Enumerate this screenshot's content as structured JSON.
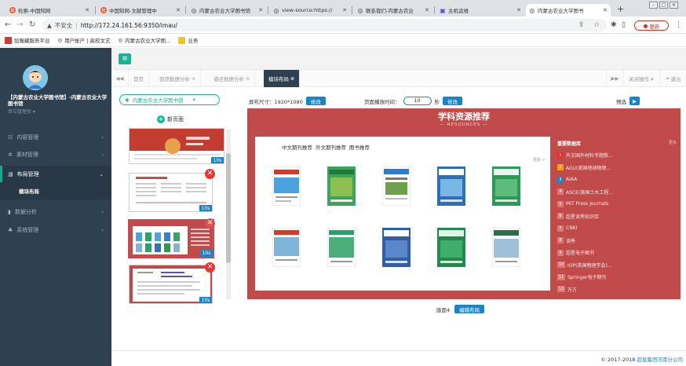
{
  "browser": {
    "tabs": [
      {
        "title": "检索-中国知网",
        "fav": "知",
        "color": "#e35d2d"
      },
      {
        "title": "中国知网-文献管理中",
        "fav": "知",
        "color": "#e35d2d"
      },
      {
        "title": "内蒙古农业大学图书馆",
        "fav": "◎",
        "color": "#444"
      },
      {
        "title": "view-source:https://",
        "fav": "◎",
        "color": "#444"
      },
      {
        "title": "联系我们-内蒙古农业",
        "fav": "◎",
        "color": "#444"
      },
      {
        "title": "主机运维",
        "fav": "▣",
        "color": "#5b4fc4"
      },
      {
        "title": "内蒙古农业大学图书",
        "fav": "◎",
        "color": "#444"
      }
    ],
    "new_tab": "+",
    "address": {
      "insecure_label": "不安全",
      "url": "http://172.24.161.56:9350/imau/"
    },
    "update_label": "更新",
    "bookmarks": [
      {
        "label": "加喔藏服务平台",
        "color": "#d23a2a"
      },
      {
        "label": "用户帐户 | 高校文艺",
        "color": "#555"
      },
      {
        "label": "内蒙古农业大学图...",
        "color": "#555"
      },
      {
        "label": "业务",
        "color": "#f5c518"
      }
    ]
  },
  "sidebar": {
    "user_name": "【内蒙古农业大学图书馆】-内蒙古农业大学图书馆",
    "role": "单位管理员 ▾",
    "menus": [
      {
        "label": "内容管理",
        "icon": "☷"
      },
      {
        "label": "素材管理",
        "icon": "✲"
      },
      {
        "label": "布局管理",
        "icon": "▤"
      },
      {
        "label": "数据分析",
        "icon": "▮"
      },
      {
        "label": "系统管理",
        "icon": "♣"
      }
    ],
    "submenu": "模块布局"
  },
  "page_tabs": {
    "back": "◀◀",
    "items": [
      "首页",
      "到馆数据分析",
      "借还数据分析",
      "模块布局"
    ],
    "forward": "▶▶",
    "close_ops": "关闭操作 ▾",
    "logout": "退出"
  },
  "left_panel": {
    "school": "内蒙古农业大学图书馆",
    "new_page": "新页面",
    "thumbs": [
      {
        "num": "",
        "badge": "10s"
      },
      {
        "num": "3",
        "badge": "10s"
      },
      {
        "num": "4",
        "badge": "10s"
      },
      {
        "num": "5",
        "badge": "10s"
      }
    ]
  },
  "toolbar": {
    "size_label": "屏布尺寸：1920*1080",
    "edit": "修改",
    "interval_label": "页面播放时间：",
    "interval_value": "10",
    "unit": "秒",
    "edit2": "修改",
    "preview": "预选"
  },
  "preview": {
    "title": "学科资源推荐",
    "subtitle": "— RESOURCES —",
    "tabs": [
      "中文期刊推荐",
      "外文期刊推荐",
      "图书推荐"
    ],
    "more": "更多 >",
    "list_title": "重要数据库",
    "list_more": "更多",
    "list": [
      "外文国外材料专题数...",
      "AGU(美国地球物理...",
      "AIAA",
      "ASCE(美国土木工程...",
      "MIT Press Journals",
      "超星读秀知识库",
      "CNKI",
      "读秀",
      "超星电子图书",
      "IOP(英国物理学会)...",
      "Springer电子期刊",
      "万方"
    ]
  },
  "caption": {
    "label": "版面4",
    "button": "编辑布局"
  },
  "footer": {
    "copyright": "© 2017-2018",
    "company": "超星集团河南分公司"
  }
}
